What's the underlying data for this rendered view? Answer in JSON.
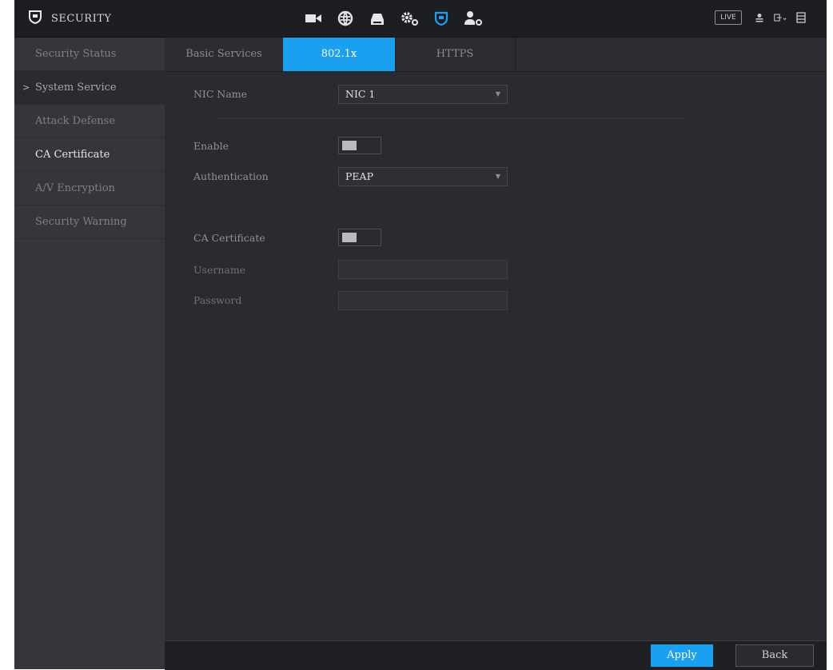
{
  "header": {
    "title": "SECURITY",
    "live_label": "LIVE",
    "nav_icons": [
      "camera-icon",
      "network-icon",
      "storage-icon",
      "system-settings-icon",
      "security-shield-icon",
      "account-icon"
    ],
    "active_nav": "security-shield-icon",
    "accent_color": "#1aa0f0"
  },
  "sidebar": {
    "items": [
      {
        "label": "Security Status"
      },
      {
        "label": "System Service"
      },
      {
        "label": "Attack Defense"
      },
      {
        "label": "CA Certificate"
      },
      {
        "label": "A/V Encryption"
      },
      {
        "label": "Security Warning"
      }
    ],
    "active_index": 1
  },
  "tabs": [
    {
      "label": "Basic Services"
    },
    {
      "label": "802.1x"
    },
    {
      "label": "HTTPS"
    }
  ],
  "form": {
    "nic_name_label": "NIC Name",
    "nic_name_value": "NIC 1",
    "enable_label": "Enable",
    "authentication_label": "Authentication",
    "authentication_value": "PEAP",
    "ca_certificate_label": "CA Certificate",
    "username_label": "Username",
    "username_value": "",
    "password_label": "Password",
    "password_value": ""
  },
  "footer": {
    "apply_label": "Apply",
    "back_label": "Back"
  }
}
